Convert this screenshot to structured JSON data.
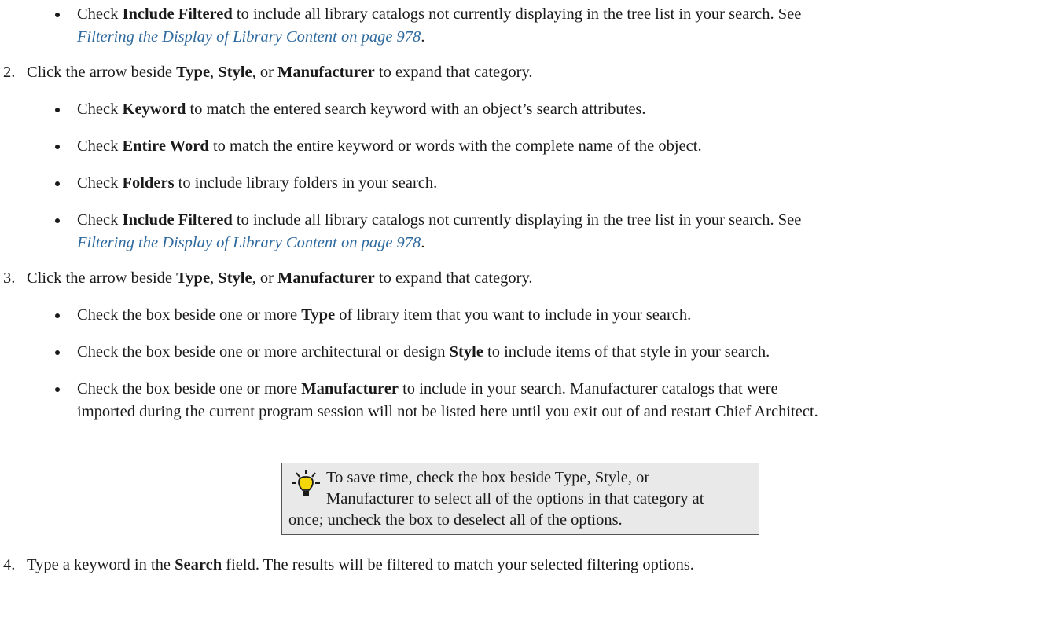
{
  "sec1": {
    "b1": {
      "pre": "Check ",
      "bold": "Include Filtered",
      "post": " to include all library catalogs not currently displaying in the tree list in your search. See",
      "link": "Filtering the Display of Library Content on page 978",
      "end": "."
    }
  },
  "step2": {
    "num": "2.",
    "pre": "Click the arrow beside ",
    "b1": "Type",
    "sep1": ", ",
    "b2": "Style",
    "sep2": ", or ",
    "b3": "Manufacturer",
    "post": " to expand that category.",
    "bullets": [
      {
        "pre": "Check ",
        "bold": "Keyword",
        "post": " to match the entered search keyword with an object’s search attributes."
      },
      {
        "pre": "Check ",
        "bold": "Entire Word",
        "post": " to match the entire keyword or words with the complete name of the object."
      },
      {
        "pre": "Check ",
        "bold": "Folders",
        "post": " to include library folders in your search."
      },
      {
        "pre": "Check ",
        "bold": "Include Filtered",
        "post": " to include all library catalogs not currently displaying in the tree list in your search. See",
        "link": "Filtering the Display of Library Content on page 978",
        "end": "."
      }
    ]
  },
  "step3": {
    "num": "3.",
    "pre": "Click the arrow beside ",
    "b1": "Type",
    "sep1": ", ",
    "b2": "Style",
    "sep2": ", or ",
    "b3": "Manufacturer",
    "post": " to expand that category.",
    "bullets": [
      {
        "pre": "Check the box beside one or more ",
        "bold": "Type",
        "post": " of library item that you want to include in your search."
      },
      {
        "pre": "Check the box beside one or more architectural or design ",
        "bold": "Style",
        "post": " to include items of that style in your search."
      },
      {
        "pre": "Check the box beside one or more ",
        "bold": "Manufacturer",
        "post": " to include in your search. Manufacturer catalogs that were",
        "cont": "imported during the current program session will not be listed here until you exit out of and restart Chief Architect."
      }
    ]
  },
  "tip": {
    "icon": "lightbulb-icon",
    "line1": "To save time, check the box beside Type, Style, or",
    "line2": "Manufacturer to select all of the options in that category at",
    "line3": "once; uncheck the box to deselect all of the options."
  },
  "step4": {
    "num": "4.",
    "pre": "Type a keyword in the ",
    "bold": "Search",
    "post": " field. The results will be filtered to match your selected filtering options."
  },
  "colors": {
    "link": "#2f6a9e",
    "tip_bg": "#e9e9e9",
    "bulb": "#f5d60b"
  }
}
